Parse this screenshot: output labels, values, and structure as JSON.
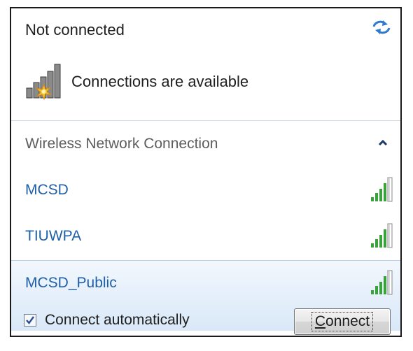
{
  "status": {
    "title": "Not connected",
    "availability": "Connections are available",
    "refresh_icon": "refresh-arrows-icon",
    "availability_icon": "signal-bars-with-starburst-icon"
  },
  "section": {
    "label": "Wireless Network Connection",
    "collapse_icon": "chevron-up-icon"
  },
  "networks": [
    {
      "name": "MCSD",
      "signal_bars": 5,
      "selected": false
    },
    {
      "name": "TIUWPA",
      "signal_bars": 5,
      "selected": false
    },
    {
      "name": "MCSD_Public",
      "signal_bars": 5,
      "selected": true
    }
  ],
  "selected_network": {
    "connect_automatically_label": "Connect automatically",
    "connect_automatically_checked": true,
    "connect_button_label": "Connect",
    "connect_button_accesskey": "C"
  },
  "colors": {
    "network_name": "#1f5fa8",
    "signal_green": "#3aa23a",
    "selection_bg": "#dce9f8",
    "border": "#1a1a1a"
  }
}
